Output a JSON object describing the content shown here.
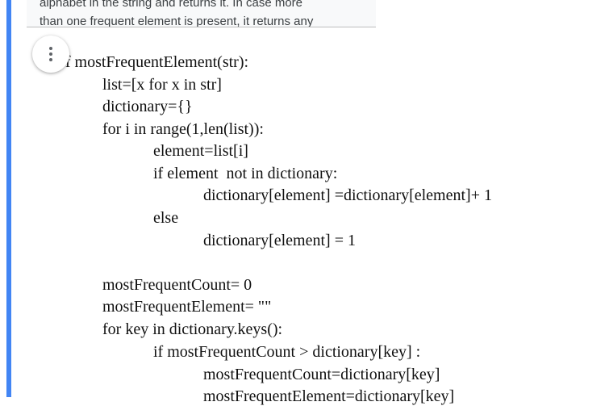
{
  "question": {
    "line1": "alphabet in the string and returns it. In case more",
    "line2": "than one frequent element is present, it returns any"
  },
  "more_button": {
    "icon": "more-vert-icon"
  },
  "code": {
    "lines": [
      "def mostFrequentElement(str):",
      "list=[x for x in str]",
      "dictionary={}",
      "for i in range(1,len(list)):",
      "element=list[i]",
      "if element  not in dictionary:",
      "dictionary[element] =dictionary[element]+ 1",
      "else",
      "dictionary[element] = 1",
      "mostFrequentCount= 0",
      "mostFrequentElement= \"\"",
      "for key in dictionary.keys():",
      "if mostFrequentCount > dictionary[key] :",
      "mostFrequentCount=dictionary[key]",
      "mostFrequentElement=dictionary[key]"
    ]
  },
  "colors": {
    "accent": "#4285f4",
    "card_background": "#f8f9fa",
    "text": "#111111"
  }
}
